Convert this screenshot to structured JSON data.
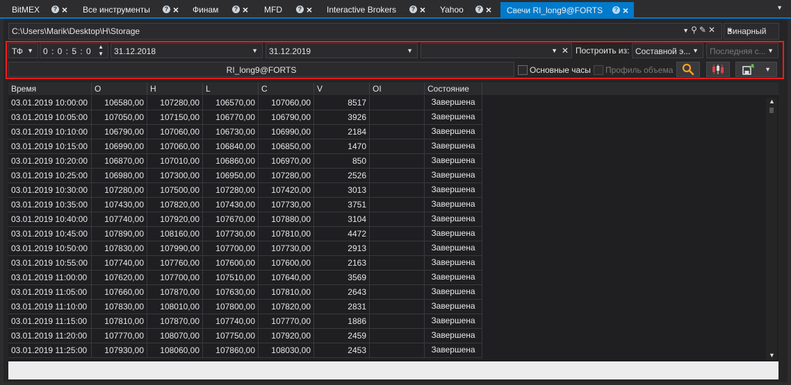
{
  "tabs": [
    {
      "label": "BitMEX",
      "active": false
    },
    {
      "label": "Все инструменты",
      "active": false
    },
    {
      "label": "Финам",
      "active": false
    },
    {
      "label": "MFD",
      "active": false
    },
    {
      "label": "Interactive Brokers",
      "active": false
    },
    {
      "label": "Yahoo",
      "active": false
    },
    {
      "label": "Свечи RI_long9@FORTS",
      "active": true
    }
  ],
  "path": {
    "value": "C:\\Users\\Marik\\Desktop\\H\\Storage"
  },
  "format": {
    "selected": "Бинарный"
  },
  "toolbar": {
    "tf_label": "ТФ",
    "timeframe": "0 : 0 : 5 : 0",
    "from_date": "31.12.2018",
    "to_date": "31.12.2019",
    "build_from_label": "Построить из:",
    "build_from_value": "Составной э...",
    "last_value": "Последняя с...",
    "security": "RI_long9@FORTS",
    "main_hours_label": "Основные часы",
    "volume_profile_label": "Профиль объема"
  },
  "columns": [
    "Время",
    "O",
    "H",
    "L",
    "C",
    "V",
    "OI",
    "Состояние"
  ],
  "rows": [
    [
      "03.01.2019 10:00:00",
      "106580,00",
      "107280,00",
      "106570,00",
      "107060,00",
      "8517",
      "",
      "Завершена"
    ],
    [
      "03.01.2019 10:05:00",
      "107050,00",
      "107150,00",
      "106770,00",
      "106790,00",
      "3926",
      "",
      "Завершена"
    ],
    [
      "03.01.2019 10:10:00",
      "106790,00",
      "107060,00",
      "106730,00",
      "106990,00",
      "2184",
      "",
      "Завершена"
    ],
    [
      "03.01.2019 10:15:00",
      "106990,00",
      "107060,00",
      "106840,00",
      "106850,00",
      "1470",
      "",
      "Завершена"
    ],
    [
      "03.01.2019 10:20:00",
      "106870,00",
      "107010,00",
      "106860,00",
      "106970,00",
      "850",
      "",
      "Завершена"
    ],
    [
      "03.01.2019 10:25:00",
      "106980,00",
      "107300,00",
      "106950,00",
      "107280,00",
      "2526",
      "",
      "Завершена"
    ],
    [
      "03.01.2019 10:30:00",
      "107280,00",
      "107500,00",
      "107280,00",
      "107420,00",
      "3013",
      "",
      "Завершена"
    ],
    [
      "03.01.2019 10:35:00",
      "107430,00",
      "107820,00",
      "107430,00",
      "107730,00",
      "3751",
      "",
      "Завершена"
    ],
    [
      "03.01.2019 10:40:00",
      "107740,00",
      "107920,00",
      "107670,00",
      "107880,00",
      "3104",
      "",
      "Завершена"
    ],
    [
      "03.01.2019 10:45:00",
      "107890,00",
      "108160,00",
      "107730,00",
      "107810,00",
      "4472",
      "",
      "Завершена"
    ],
    [
      "03.01.2019 10:50:00",
      "107830,00",
      "107990,00",
      "107700,00",
      "107730,00",
      "2913",
      "",
      "Завершена"
    ],
    [
      "03.01.2019 10:55:00",
      "107740,00",
      "107760,00",
      "107600,00",
      "107600,00",
      "2163",
      "",
      "Завершена"
    ],
    [
      "03.01.2019 11:00:00",
      "107620,00",
      "107700,00",
      "107510,00",
      "107640,00",
      "3569",
      "",
      "Завершена"
    ],
    [
      "03.01.2019 11:05:00",
      "107660,00",
      "107870,00",
      "107630,00",
      "107810,00",
      "2643",
      "",
      "Завершена"
    ],
    [
      "03.01.2019 11:10:00",
      "107830,00",
      "108010,00",
      "107800,00",
      "107820,00",
      "2831",
      "",
      "Завершена"
    ],
    [
      "03.01.2019 11:15:00",
      "107810,00",
      "107870,00",
      "107740,00",
      "107770,00",
      "1886",
      "",
      "Завершена"
    ],
    [
      "03.01.2019 11:20:00",
      "107770,00",
      "108070,00",
      "107750,00",
      "107920,00",
      "2459",
      "",
      "Завершена"
    ],
    [
      "03.01.2019 11:25:00",
      "107930,00",
      "108060,00",
      "107860,00",
      "108030,00",
      "2453",
      "",
      "Завершена"
    ]
  ],
  "colors": {
    "accent": "#007acc",
    "highlight": "#ff1a1a",
    "search": "#ffa020",
    "candle_red": "#e04040"
  }
}
